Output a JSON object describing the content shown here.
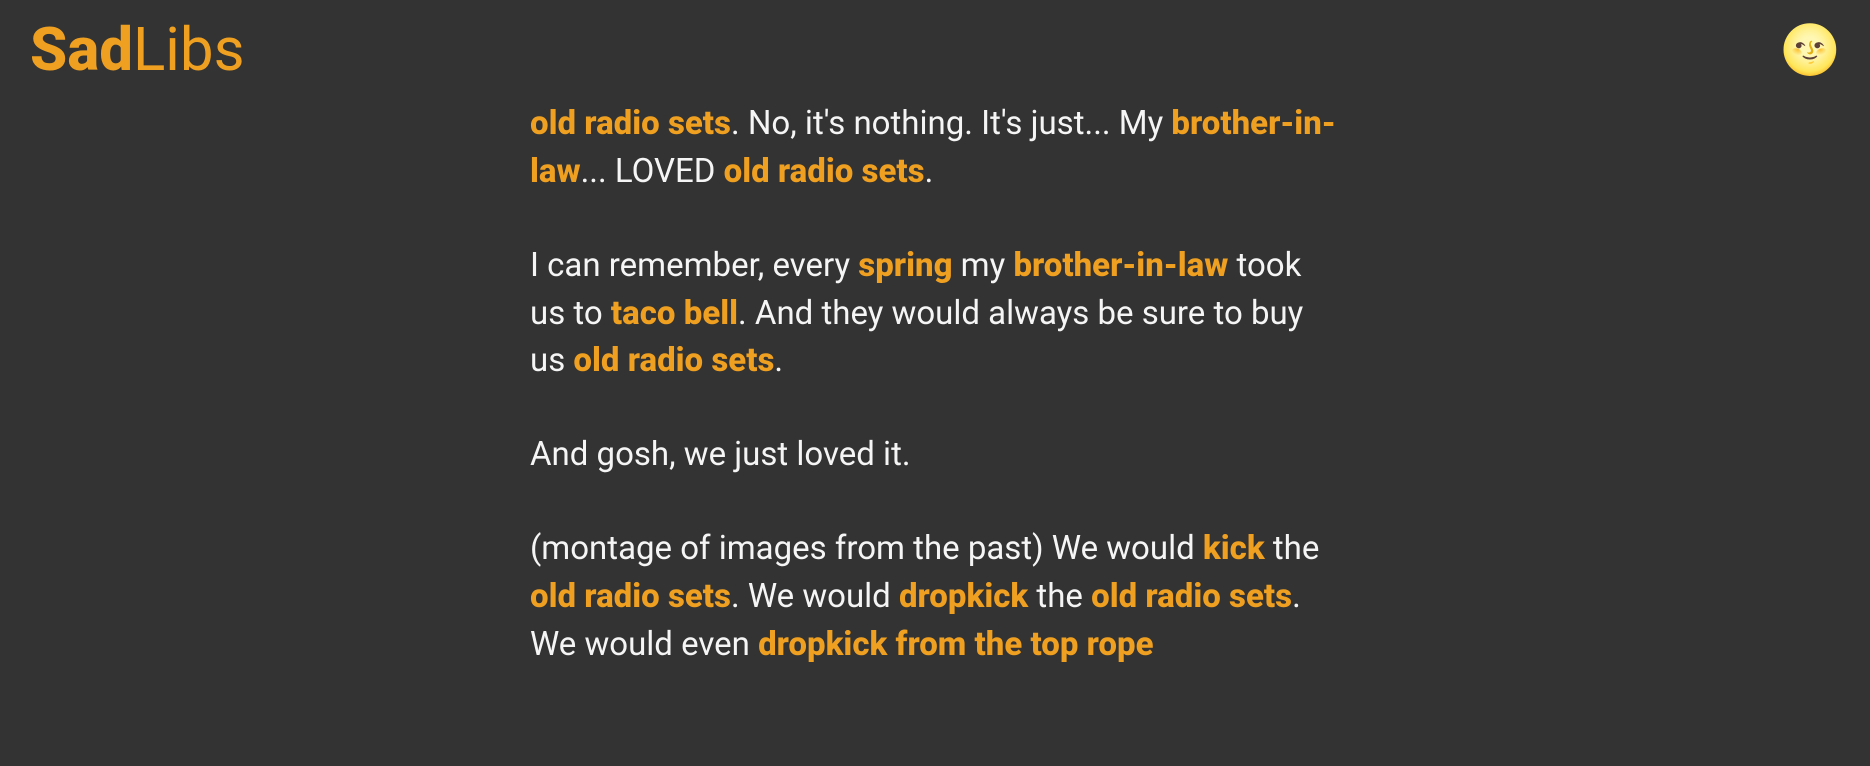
{
  "header": {
    "logo_bold": "Sad",
    "logo_light": "Libs",
    "theme_icon": "🌝"
  },
  "story": {
    "p1": {
      "h1": "old radio sets",
      "t1": ". No, it's nothing. It's just... My ",
      "h2": "brother-in-law",
      "t2": "... LOVED ",
      "h3": "old radio sets",
      "t3": "."
    },
    "p2": {
      "t1": "I can remember, every ",
      "h1": "spring",
      "t2": " my ",
      "h2": "brother-in-law",
      "t3": " took us to ",
      "h3": "taco bell",
      "t4": ". And they would always be sure to buy us ",
      "h4": "old radio sets",
      "t5": "."
    },
    "p3": {
      "t1": "And gosh, we just loved it."
    },
    "p4": {
      "t1": "(montage of images from the past) We would ",
      "h1": "kick",
      "t2": " the ",
      "h2": "old radio sets",
      "t3": ". We would ",
      "h3": "dropkick",
      "t4": " the ",
      "h4": "old radio sets",
      "t5": ". We would even ",
      "h5": "dropkick from the top rope"
    }
  }
}
